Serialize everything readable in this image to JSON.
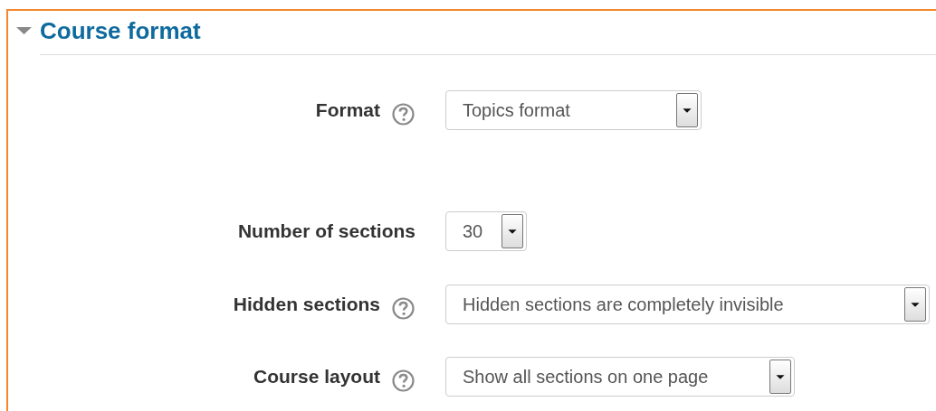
{
  "section": {
    "title": "Course format",
    "expanded": true
  },
  "fields": [
    {
      "label": "Format",
      "help": true,
      "value": "Topics format"
    },
    {
      "label": "Number of sections",
      "help": false,
      "value": "30"
    },
    {
      "label": "Hidden sections",
      "help": true,
      "value": "Hidden sections are completely invisible"
    },
    {
      "label": "Course layout",
      "help": true,
      "value": "Show all sections on one page"
    }
  ]
}
